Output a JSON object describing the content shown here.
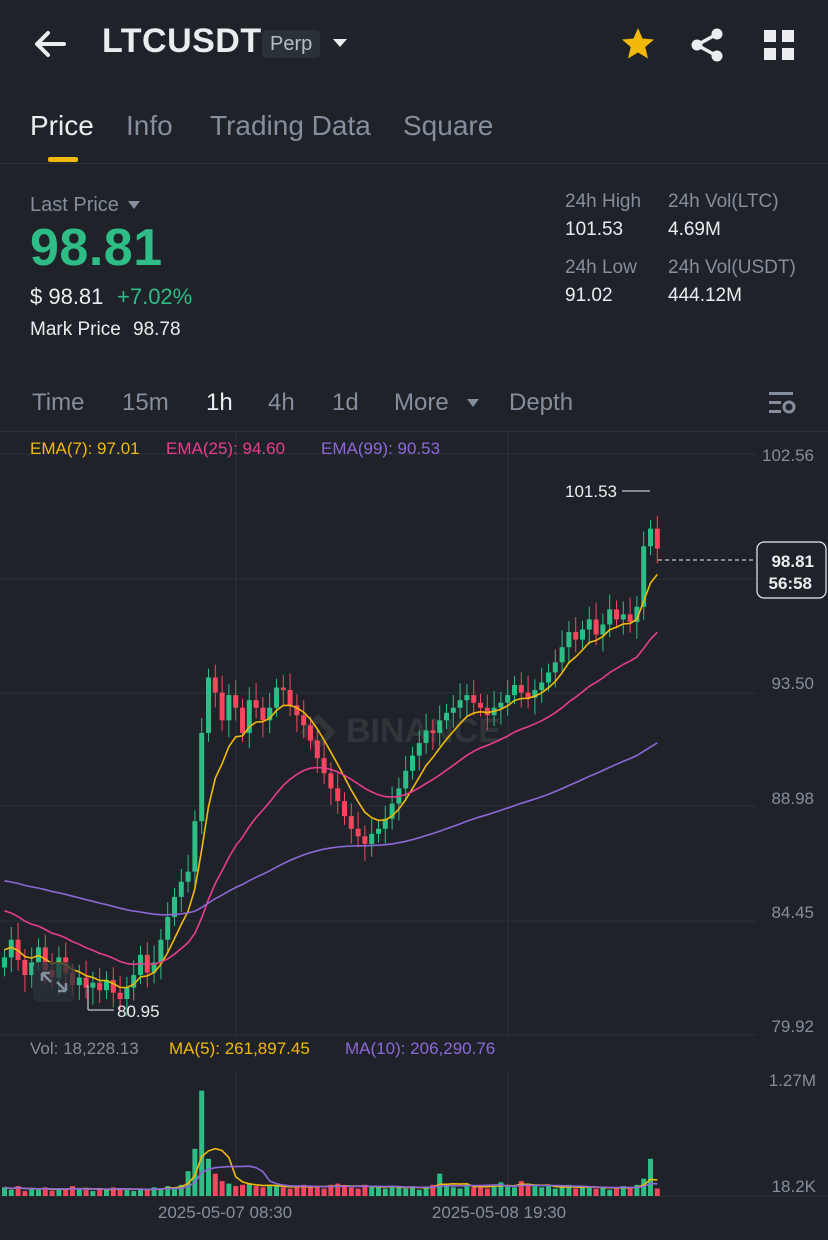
{
  "header": {
    "symbol": "LTCUSDT",
    "contract_type": "Perp"
  },
  "tabs": [
    {
      "label": "Price",
      "active": true
    },
    {
      "label": "Info",
      "active": false
    },
    {
      "label": "Trading Data",
      "active": false
    },
    {
      "label": "Square",
      "active": false
    }
  ],
  "price": {
    "last_price_label": "Last Price",
    "last_price": "98.81",
    "usd_price": "$ 98.81",
    "change_pct": "+7.02%",
    "mark_price_label": "Mark Price",
    "mark_price": "98.78"
  },
  "stats": {
    "high_label": "24h High",
    "high": "101.53",
    "low_label": "24h Low",
    "low": "91.02",
    "vol_ltc_label": "24h Vol(LTC)",
    "vol_ltc": "4.69M",
    "vol_usdt_label": "24h Vol(USDT)",
    "vol_usdt": "444.12M"
  },
  "intervals": [
    {
      "label": "Time",
      "active": false
    },
    {
      "label": "15m",
      "active": false
    },
    {
      "label": "1h",
      "active": true
    },
    {
      "label": "4h",
      "active": false
    },
    {
      "label": "1d",
      "active": false
    },
    {
      "label": "More",
      "active": false
    },
    {
      "label": "Depth",
      "active": false
    }
  ],
  "indicators": {
    "ema7_label": "EMA(7): 97.01",
    "ema25_label": "EMA(25): 94.60",
    "ema99_label": "EMA(99): 90.53",
    "vol_label": "Vol: 18,228.13",
    "ma5_label": "MA(5): 261,897.45",
    "ma10_label": "MA(10): 206,290.76"
  },
  "colors": {
    "up": "#2ebd85",
    "down": "#f6465d",
    "ema7": "#f0b90b",
    "ema25": "#e93c8f",
    "ema99": "#8e67d8",
    "accent": "#f0b90b"
  },
  "chart_data": {
    "type": "candlestick",
    "price_axis_labels": [
      "102.56",
      "93.50",
      "88.98",
      "84.45",
      "79.92"
    ],
    "volume_axis_labels": [
      "1.27M",
      "18.2K"
    ],
    "time_labels": [
      "2025-05-07 08:30",
      "2025-05-08 19:30"
    ],
    "ylim": [
      79.92,
      102.56
    ],
    "high_marker": "101.53",
    "low_marker": "80.95",
    "current_price_tag": "98.81",
    "countdown": "56:58",
    "watermark": "BINANCE",
    "closes": [
      82.6,
      83.3,
      82.5,
      81.9,
      82.4,
      83.0,
      82.1,
      81.8,
      82.6,
      82.0,
      81.5,
      81.8,
      81.4,
      81.6,
      81.3,
      81.7,
      81.2,
      80.95,
      81.4,
      81.9,
      82.7,
      82.0,
      82.4,
      83.3,
      84.2,
      85.0,
      85.6,
      86.0,
      88.0,
      91.5,
      93.7,
      93.1,
      92.0,
      93.0,
      92.5,
      91.5,
      92.8,
      92.5,
      92.0,
      92.5,
      93.3,
      93.2,
      92.6,
      92.2,
      91.8,
      91.2,
      90.5,
      89.9,
      89.3,
      88.8,
      88.2,
      87.7,
      87.4,
      87.1,
      87.5,
      87.7,
      88.1,
      88.7,
      89.3,
      90.0,
      90.6,
      91.1,
      91.6,
      91.5,
      92.0,
      92.3,
      92.5,
      92.8,
      93.0,
      92.7,
      92.5,
      92.2,
      92.5,
      92.7,
      93.0,
      93.4,
      93.1,
      92.9,
      93.2,
      93.5,
      93.9,
      94.3,
      94.9,
      95.5,
      95.2,
      95.6,
      96.0,
      95.4,
      95.8,
      96.4,
      96.0,
      96.2,
      95.9,
      96.5,
      98.9,
      99.6,
      98.81
    ],
    "volumes": [
      0.07,
      0.05,
      0.08,
      0.04,
      0.06,
      0.05,
      0.07,
      0.04,
      0.06,
      0.05,
      0.08,
      0.06,
      0.05,
      0.04,
      0.06,
      0.05,
      0.07,
      0.06,
      0.05,
      0.04,
      0.06,
      0.05,
      0.07,
      0.06,
      0.08,
      0.07,
      0.09,
      0.2,
      0.38,
      0.85,
      0.3,
      0.18,
      0.12,
      0.1,
      0.08,
      0.09,
      0.1,
      0.08,
      0.07,
      0.09,
      0.08,
      0.07,
      0.06,
      0.08,
      0.09,
      0.07,
      0.08,
      0.06,
      0.09,
      0.1,
      0.08,
      0.07,
      0.06,
      0.09,
      0.08,
      0.07,
      0.06,
      0.08,
      0.07,
      0.06,
      0.08,
      0.05,
      0.07,
      0.09,
      0.18,
      0.08,
      0.07,
      0.06,
      0.1,
      0.07,
      0.08,
      0.06,
      0.09,
      0.11,
      0.08,
      0.07,
      0.12,
      0.09,
      0.08,
      0.07,
      0.08,
      0.06,
      0.07,
      0.09,
      0.06,
      0.07,
      0.08,
      0.06,
      0.07,
      0.05,
      0.07,
      0.08,
      0.06,
      0.09,
      0.14,
      0.3,
      0.06
    ]
  }
}
